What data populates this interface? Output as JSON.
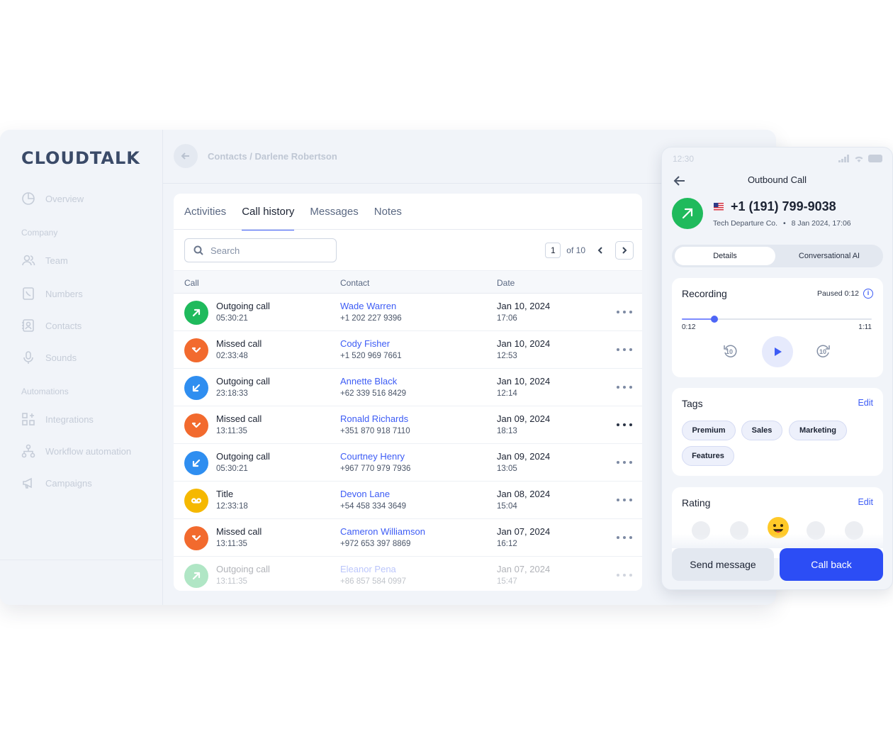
{
  "app": {
    "logo": "CLOUDTALK",
    "sidebar": {
      "items": [
        {
          "label": "Overview",
          "icon": "pie-chart-icon"
        },
        {
          "label": "Team",
          "icon": "users-icon"
        },
        {
          "label": "Numbers",
          "icon": "phone-doc-icon"
        },
        {
          "label": "Contacts",
          "icon": "contacts-book-icon"
        },
        {
          "label": "Sounds",
          "icon": "microphone-icon"
        },
        {
          "label": "Integrations",
          "icon": "grid-plus-icon"
        },
        {
          "label": "Workflow automation",
          "icon": "workflow-icon"
        },
        {
          "label": "Campaigns",
          "icon": "megaphone-icon"
        }
      ],
      "sections": {
        "company": "Company",
        "automations": "Automations"
      }
    },
    "breadcrumb": "Contacts / Darlene Robertson"
  },
  "call_history": {
    "tabs": [
      "Activities",
      "Call history",
      "Messages",
      "Notes"
    ],
    "active_tab": "Call history",
    "search_placeholder": "Search",
    "pager": {
      "current": "1",
      "of_label": "of 10"
    },
    "columns": [
      "Call",
      "Contact",
      "Date"
    ],
    "rows": [
      {
        "type": "Outgoing call",
        "duration": "05:30:21",
        "contact": "Wade Warren",
        "phone": "+1 202 227 9396",
        "date": "Jan 10, 2024",
        "time": "17:06"
      },
      {
        "type": "Missed call",
        "duration": "02:33:48",
        "contact": "Cody Fisher",
        "phone": "+1 520 969 7661",
        "date": "Jan 10, 2024",
        "time": "12:53"
      },
      {
        "type": "Outgoing call",
        "duration": "23:18:33",
        "contact": "Annette Black",
        "phone": "+62 339 516 8429",
        "date": "Jan 10, 2024",
        "time": "12:14"
      },
      {
        "type": "Missed call",
        "duration": "13:11:35",
        "contact": "Ronald Richards",
        "phone": "+351 870 918 7110",
        "date": "Jan 09, 2024",
        "time": "18:13"
      },
      {
        "type": "Outgoing call",
        "duration": "05:30:21",
        "contact": "Courtney Henry",
        "phone": "+967 770 979 7936",
        "date": "Jan 09, 2024",
        "time": "13:05"
      },
      {
        "type": "Title",
        "duration": "12:33:18",
        "contact": "Devon Lane",
        "phone": "+54 458 334 3649",
        "date": "Jan 08, 2024",
        "time": "15:04"
      },
      {
        "type": "Missed call",
        "duration": "13:11:35",
        "contact": "Cameron Williamson",
        "phone": "+972 653 397 8869",
        "date": "Jan 07, 2024",
        "time": "16:12"
      },
      {
        "type": "Outgoing call",
        "duration": "13:11:35",
        "contact": "Eleanor Pena",
        "phone": "+86 857 584 0997",
        "date": "Jan 07, 2024",
        "time": "15:47"
      }
    ]
  },
  "phone": {
    "status_time": "12:30",
    "title": "Outbound Call",
    "number": "+1 (191) 799-9038",
    "company": "Tech Departure Co.",
    "date": "8 Jan 2024,  17:06",
    "segments": [
      "Details",
      "Conversational AI"
    ],
    "recording": {
      "title": "Recording",
      "status": "Paused 0:12",
      "current": "0:12",
      "total": "1:11",
      "progress": 0.17,
      "skip": "10"
    },
    "tags": {
      "title": "Tags",
      "edit": "Edit",
      "items": [
        "Premium",
        "Sales",
        "Marketing",
        "Features"
      ]
    },
    "rating": {
      "title": "Rating",
      "edit": "Edit"
    },
    "send_message": "Send message",
    "call_back": "Call back"
  },
  "colors": {
    "accent": "#3d5cf5",
    "outgoing": "#1fba5c",
    "incoming": "#2f8ef0",
    "missed": "#f26a2e",
    "voicemail": "#f5b800"
  }
}
